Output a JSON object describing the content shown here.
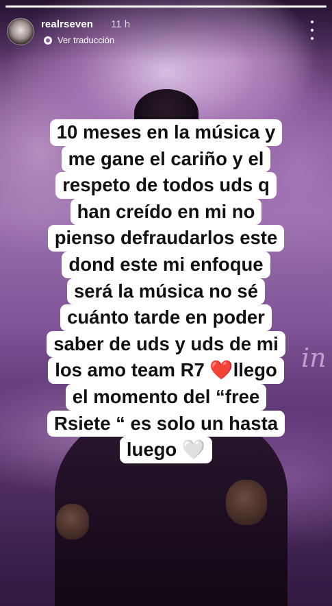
{
  "story": {
    "username": "realrseven",
    "time": "11 h",
    "translate_label": "Ver traducción",
    "progress_fraction": 1.0
  },
  "caption": {
    "lines": [
      "10 meses en la música y",
      "me gane el cariño y el",
      "respeto de todos uds q",
      "han creído en mi no",
      "pienso defraudarlos este",
      "dond este mi enfoque",
      "será la música no sé",
      "cuánto tarde en poder",
      "saber de uds y uds de mi",
      "los amo team R7 ❤️llego",
      "el momento del “free",
      "Rsiete “ es solo un hasta",
      "luego 🤍"
    ]
  },
  "background": {
    "script_text_right": "in",
    "accent_color": "#8a5a9c"
  }
}
